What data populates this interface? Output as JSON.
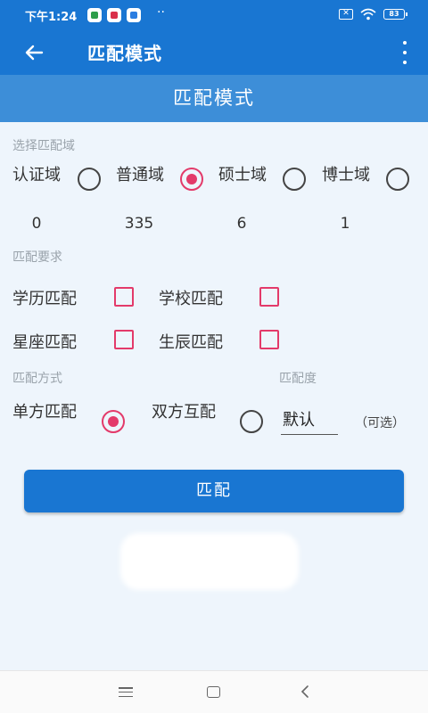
{
  "status_bar": {
    "time": "下午1:24",
    "more": "··",
    "sim": "✕",
    "battery": "83"
  },
  "app_bar": {
    "title": "匹配模式"
  },
  "header": {
    "title": "匹配模式"
  },
  "domain_section": {
    "label": "选择匹配域",
    "options": [
      {
        "label": "认证域",
        "count": "0",
        "selected": false
      },
      {
        "label": "普通域",
        "count": "335",
        "selected": true
      },
      {
        "label": "硕士域",
        "count": "6",
        "selected": false
      },
      {
        "label": "博士域",
        "count": "1",
        "selected": false
      }
    ]
  },
  "requirements": {
    "label": "匹配要求",
    "items": [
      {
        "label": "学历匹配",
        "checked": false
      },
      {
        "label": "学校匹配",
        "checked": false
      },
      {
        "label": "星座匹配",
        "checked": false
      },
      {
        "label": "生辰匹配",
        "checked": false
      }
    ]
  },
  "method": {
    "label": "匹配方式",
    "options": [
      {
        "label": "单方匹配",
        "selected": true
      },
      {
        "label": "双方互配",
        "selected": false
      }
    ]
  },
  "degree": {
    "label": "匹配度",
    "value": "默认",
    "note": "（可选）"
  },
  "button": {
    "label": "匹配"
  },
  "colors": {
    "primary": "#1976d2",
    "header": "#3d8ed8",
    "accent": "#e33a6a",
    "background": "#eef5fc"
  }
}
